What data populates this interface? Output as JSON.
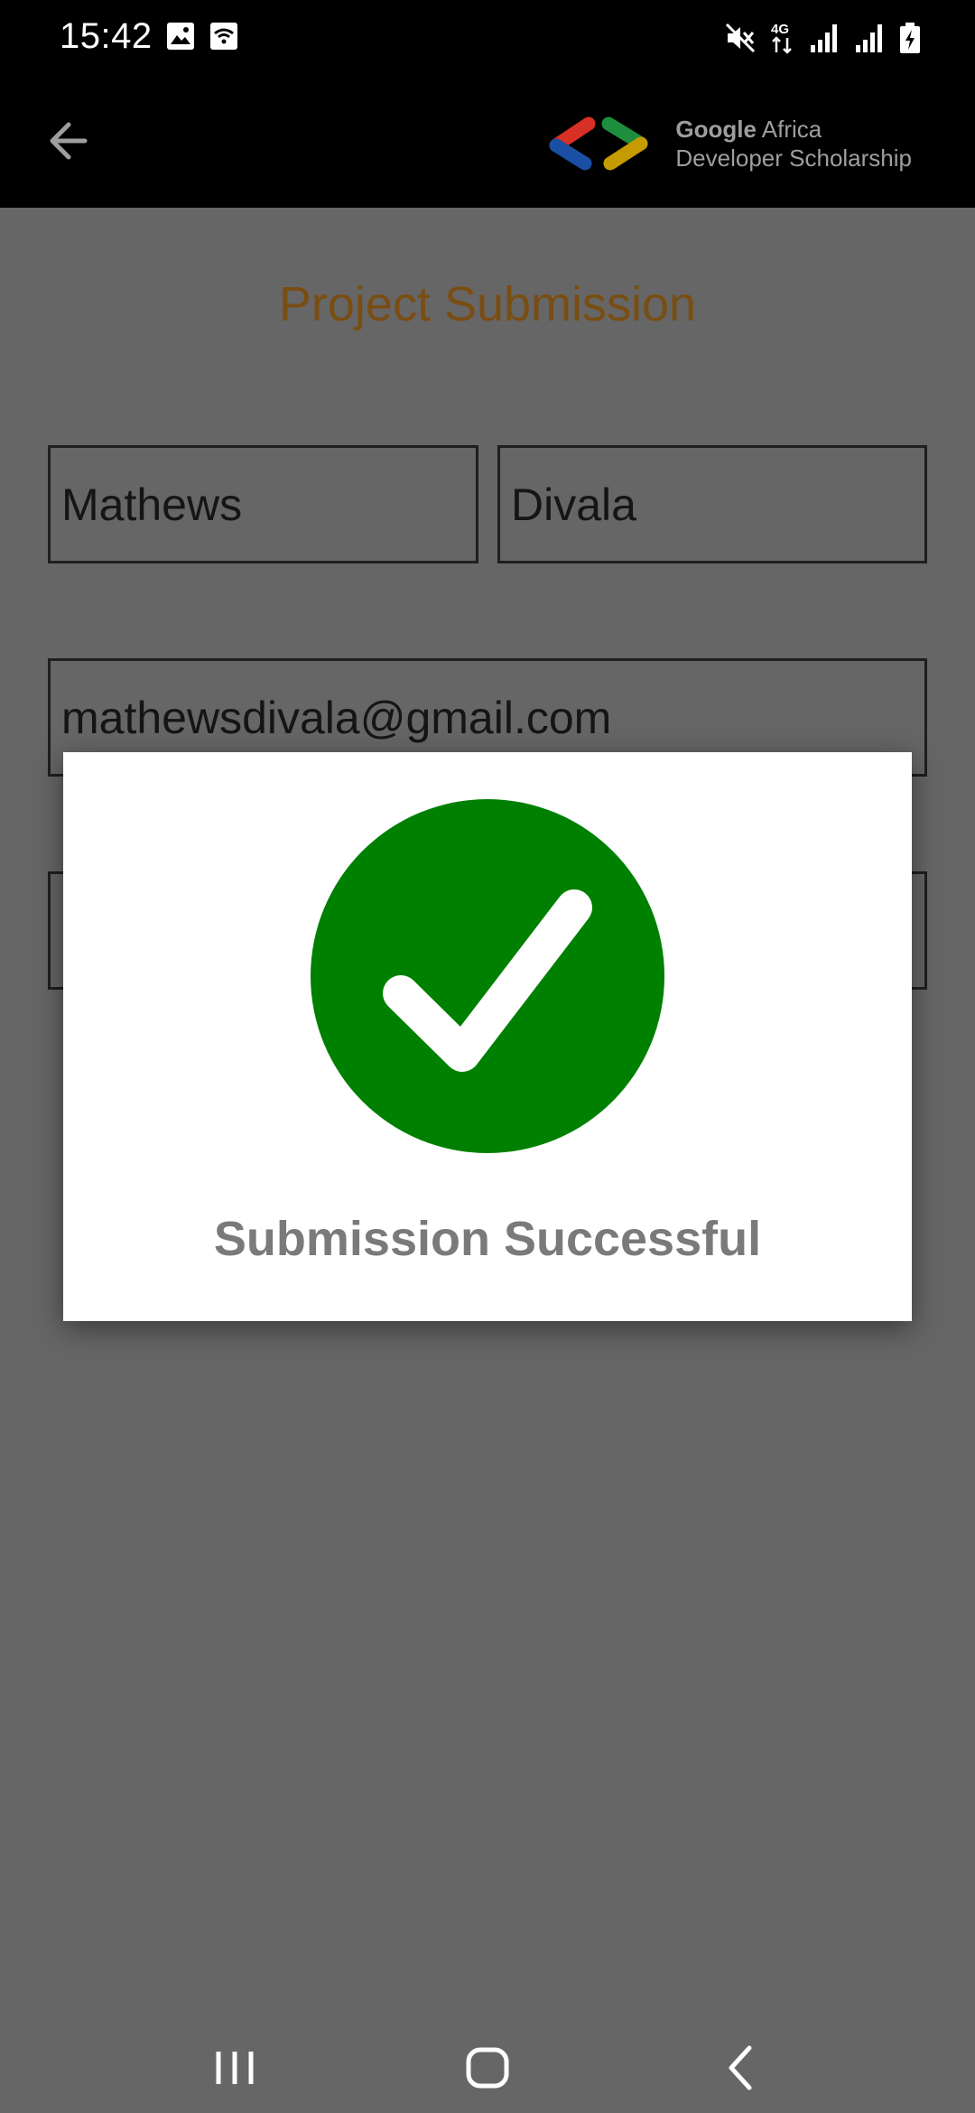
{
  "status_bar": {
    "time": "15:42",
    "network_label": "4G"
  },
  "app_bar": {
    "brand_line1_bold": "Google",
    "brand_line1_rest": "Africa",
    "brand_line2": "Developer Scholarship"
  },
  "form": {
    "title": "Project Submission",
    "first_name": "Mathews",
    "last_name": "Divala",
    "email": "mathewsdivala@gmail.com",
    "github_link": ""
  },
  "dialog": {
    "message": "Submission Successful",
    "icon": "check-circle-icon",
    "icon_color": "#008000"
  },
  "colors": {
    "title": "#7a4d13",
    "scrim": "#666666",
    "bar": "#000000"
  }
}
